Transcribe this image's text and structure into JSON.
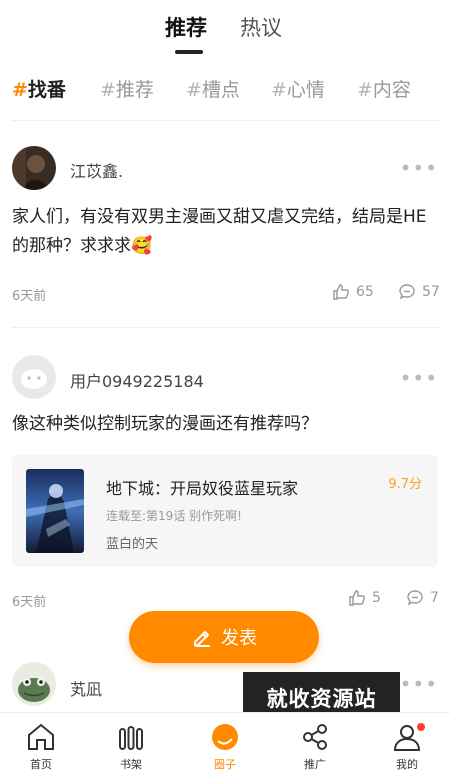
{
  "top_tabs": [
    {
      "label": "推荐",
      "active": true
    },
    {
      "label": "热议",
      "active": false
    }
  ],
  "topics": [
    {
      "label": "找番",
      "active": true
    },
    {
      "label": "推荐",
      "active": false
    },
    {
      "label": "槽点",
      "active": false
    },
    {
      "label": "心情",
      "active": false
    },
    {
      "label": "内容",
      "active": false
    }
  ],
  "posts": [
    {
      "username": "江苡鑫.",
      "text": "家人们，有没有双男主漫画又甜又虐又完结，结局是HE的那种？求求求🥰",
      "time": "6天前",
      "likes": "65",
      "comments": "57"
    },
    {
      "username": "用户0949225184",
      "text": "像这种类似控制玩家的漫画还有推荐吗？",
      "time": "6天前",
      "likes": "5",
      "comments": "7",
      "card": {
        "title": "地下城：开局奴役蓝星玩家",
        "score": "9.7分",
        "update": "连载至:第19话 别作死啊!",
        "author": "蓝白的天"
      }
    },
    {
      "username": "芄凪"
    }
  ],
  "publish_label": "发表",
  "watermark": "就收资源站",
  "bottom_nav": [
    {
      "label": "首页",
      "icon": "home-icon",
      "active": false
    },
    {
      "label": "书架",
      "icon": "bookshelf-icon",
      "active": false
    },
    {
      "label": "圈子",
      "icon": "circle-icon",
      "active": true
    },
    {
      "label": "推广",
      "icon": "share-icon",
      "active": false
    },
    {
      "label": "我的",
      "icon": "profile-icon",
      "active": false,
      "badge": true
    }
  ],
  "colors": {
    "accent": "#ff8a00",
    "score": "#ff9f1a",
    "badge": "#ff3b30"
  }
}
